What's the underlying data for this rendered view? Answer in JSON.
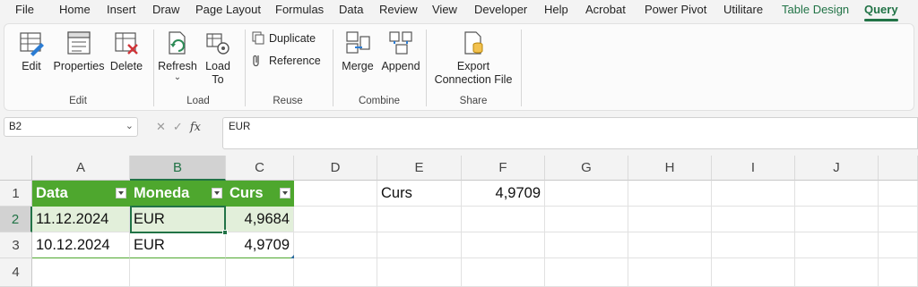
{
  "menu": {
    "tabs": [
      "File",
      "Home",
      "Insert",
      "Draw",
      "Page Layout",
      "Formulas",
      "Data",
      "Review",
      "View",
      "Developer",
      "Help",
      "Acrobat",
      "Power Pivot",
      "Utilitare",
      "Table Design",
      "Query"
    ]
  },
  "ribbon": {
    "edit_group": {
      "label": "Edit",
      "edit": "Edit",
      "properties": "Properties",
      "delete": "Delete"
    },
    "load_group": {
      "label": "Load",
      "refresh": "Refresh",
      "load_to_1": "Load",
      "load_to_2": "To"
    },
    "reuse_group": {
      "label": "Reuse",
      "duplicate": "Duplicate",
      "reference": "Reference"
    },
    "combine_group": {
      "label": "Combine",
      "merge": "Merge",
      "append": "Append"
    },
    "share_group": {
      "label": "Share",
      "export_1": "Export",
      "export_2": "Connection File"
    }
  },
  "formula_bar": {
    "name_box": "B2",
    "formula": "EUR"
  },
  "sheet": {
    "columns": [
      "A",
      "B",
      "C",
      "D",
      "E",
      "F",
      "G",
      "H",
      "I",
      "J"
    ],
    "rows": [
      "1",
      "2",
      "3",
      "4"
    ],
    "table": {
      "headers": [
        "Data",
        "Moneda",
        "Curs"
      ],
      "rows": [
        [
          "11.12.2024",
          "EUR",
          "4,9684"
        ],
        [
          "10.12.2024",
          "EUR",
          "4,9709"
        ]
      ]
    },
    "e1": "Curs",
    "f1": "4,9709"
  },
  "colors": {
    "accent": "#217346",
    "table_header": "#4ea72e",
    "table_band": "#e2efda"
  }
}
